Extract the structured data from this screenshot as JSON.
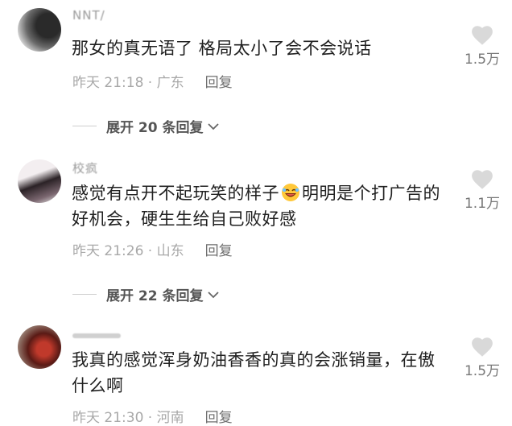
{
  "comments": [
    {
      "name": "NNT/",
      "text": "那女的真无语了 格局太小了会不会说话",
      "time": "昨天 21:18 · 广东",
      "reply_label": "回复",
      "likes": "1.5万",
      "expand_label": "展开 20 条回复"
    },
    {
      "name": "校疯",
      "text_before": "感觉有点开不起玩笑的样子",
      "emoji": "laughing-emoji",
      "text_after": "明明是个打广告的好机会，硬生生给自己败好感",
      "time": "昨天 21:26 · 山东",
      "reply_label": "回复",
      "likes": "1.1万",
      "expand_label": "展开 22 条回复"
    },
    {
      "name": "",
      "text": "我真的感觉浑身奶油香香的真的会涨销量，在傲什么啊",
      "time": "昨天 21:30 · 河南",
      "reply_label": "回复",
      "likes": "1.5万"
    }
  ],
  "icons": {
    "like": "heart-icon",
    "expand": "chevron-down-icon"
  },
  "colors": {
    "heart": "#d9d9d9",
    "meta": "#a8a8a8",
    "text": "#202020"
  }
}
